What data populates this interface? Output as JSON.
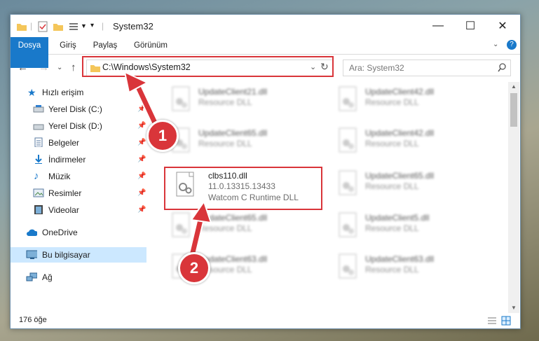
{
  "window": {
    "title": "System32"
  },
  "ribbon": {
    "tabs": [
      "Dosya",
      "Giriş",
      "Paylaş",
      "Görünüm"
    ]
  },
  "address": {
    "path": "C:\\Windows\\System32"
  },
  "search": {
    "placeholder": "Ara: System32"
  },
  "sidebar": {
    "quick_access": "Hızlı erişim",
    "items": [
      {
        "label": "Yerel Disk (C:)",
        "icon": "drive-icon"
      },
      {
        "label": "Yerel Disk (D:)",
        "icon": "drive-icon"
      },
      {
        "label": "Belgeler",
        "icon": "documents-icon"
      },
      {
        "label": "İndirmeler",
        "icon": "downloads-icon"
      },
      {
        "label": "Müzik",
        "icon": "music-icon"
      },
      {
        "label": "Resimler",
        "icon": "pictures-icon"
      },
      {
        "label": "Videolar",
        "icon": "videos-icon"
      }
    ],
    "onedrive": "OneDrive",
    "this_pc": "Bu bilgisayar",
    "network": "Ağ"
  },
  "files": [
    {
      "name": "UpdateClient21.dll",
      "line1": "Resource DLL"
    },
    {
      "name": "UpdateClient42.dll",
      "line1": "Resource DLL"
    },
    {
      "name": "UpdateClient65.dll",
      "line1": "Resource DLL"
    },
    {
      "name": "UpdateClient42.dll",
      "line1": "Resource DLL"
    },
    {
      "name": "clbs110.dll",
      "line1": "11.0.13315.13433",
      "line2": "Watcom C Runtime DLL"
    },
    {
      "name": "UpdateClient65.dll",
      "line1": "Resource DLL"
    },
    {
      "name": "UpdateClient65.dll",
      "line1": "Resource DLL"
    },
    {
      "name": "UpdateClient5.dll",
      "line1": "Resource DLL"
    },
    {
      "name": "UpdateClient63.dll",
      "line1": "Resource DLL"
    },
    {
      "name": "UpdateClient63.dll",
      "line1": "Resource DLL"
    }
  ],
  "status": {
    "count": "176 öğe"
  },
  "markers": [
    "1",
    "2"
  ],
  "colors": {
    "accent": "#1979ca",
    "highlight": "#d9353a",
    "selection": "#cce8ff"
  }
}
